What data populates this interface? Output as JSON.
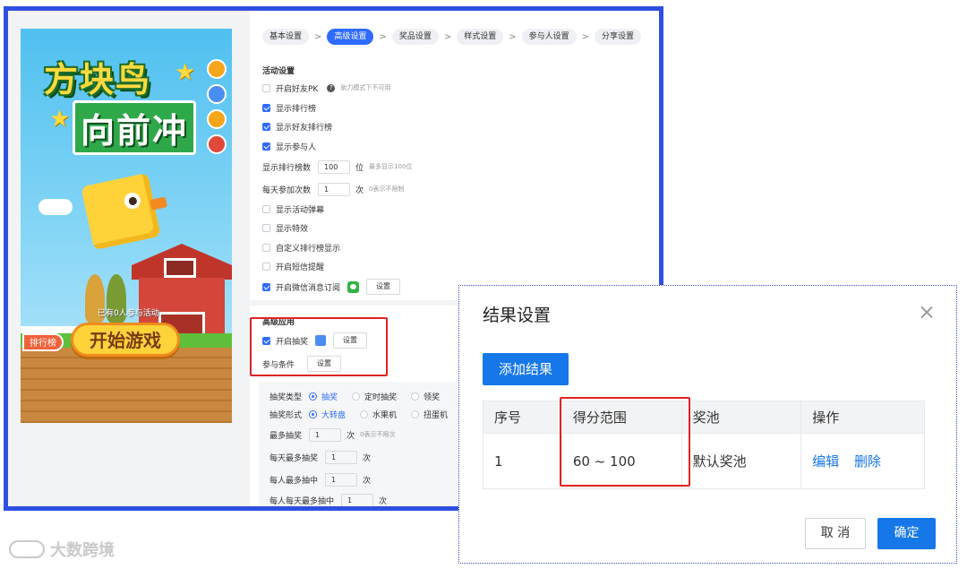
{
  "poster": {
    "title_line1": "方块鸟",
    "title_line2": "向前冲",
    "participants_text": "已有0人参与活动",
    "rank_button": "排行榜",
    "start_button": "开始游戏"
  },
  "steps": [
    {
      "label": "基本设置",
      "active": false
    },
    {
      "label": "高级设置",
      "active": true
    },
    {
      "label": "奖品设置",
      "active": false
    },
    {
      "label": "样式设置",
      "active": false
    },
    {
      "label": "参与人设置",
      "active": false
    },
    {
      "label": "分享设置",
      "active": false
    }
  ],
  "activity_settings": {
    "title": "活动设置",
    "friend_pk_label": "开启好友PK",
    "friend_pk_hint": "助力模式下不可用",
    "show_rank_label": "显示排行榜",
    "show_friend_rank_label": "显示好友排行榜",
    "show_participants_label": "显示参与人",
    "rank_count_label": "显示排行榜数",
    "rank_count_value": "100",
    "rank_count_unit": "位",
    "rank_count_hint": "最多显示100位",
    "daily_count_label": "每天参加次数",
    "daily_count_value": "1",
    "daily_count_unit": "次",
    "daily_count_hint": "0表示不限制",
    "show_popup_label": "显示活动弹幕",
    "show_effect_label": "显示特效",
    "custom_rank_label": "自定义排行榜显示",
    "sms_reminder_label": "开启短信提醒",
    "wechat_sub_label": "开启微信消息订阅",
    "wechat_sub_setting": "设置"
  },
  "advanced_apps": {
    "title": "高级应用",
    "lottery_label": "开启抽奖",
    "lottery_setting": "设置",
    "condition_label": "参与条件",
    "condition_setting": "设置"
  },
  "lottery": {
    "type_label": "抽奖类型",
    "type_options": [
      "抽奖",
      "定时抽奖",
      "领奖"
    ],
    "type_selected": 0,
    "form_label": "抽奖形式",
    "form_options": [
      "大转盘",
      "水果机",
      "扭蛋机"
    ],
    "form_selected": 0,
    "max_label": "最多抽奖",
    "max_value": "1",
    "max_unit": "次",
    "max_hint": "0表示不限次",
    "daily_max_label": "每天最多抽奖",
    "daily_max_value": "1",
    "daily_max_unit": "次",
    "per_person_label": "每人最多抽中",
    "per_person_value": "1",
    "per_person_unit": "次",
    "per_person_daily_label": "每人每天最多抽中",
    "per_person_daily_value": "1",
    "per_person_daily_unit": "次"
  },
  "watermark": "大数跨境",
  "dialog": {
    "title": "结果设置",
    "add_button": "添加结果",
    "columns": [
      "序号",
      "得分范围",
      "奖池",
      "操作"
    ],
    "rows": [
      {
        "seq": "1",
        "range": "60 ~ 100",
        "pool": "默认奖池",
        "edit": "编辑",
        "delete": "删除"
      }
    ],
    "cancel": "取 消",
    "confirm": "确定"
  }
}
